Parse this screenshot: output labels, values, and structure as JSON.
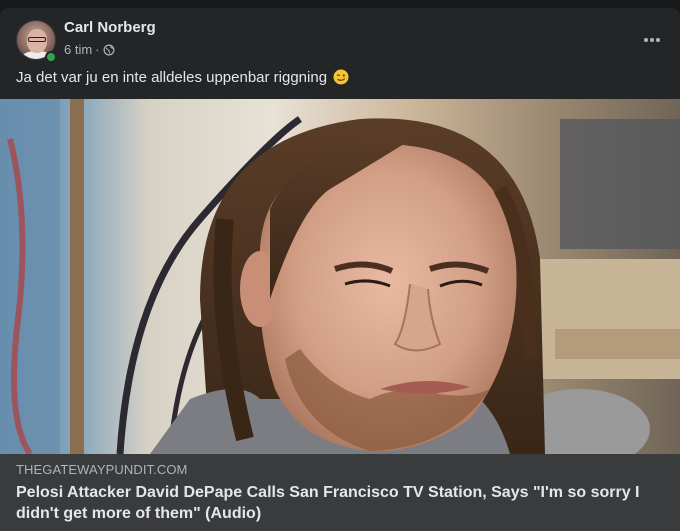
{
  "post": {
    "author": "Carl Norberg",
    "time": "6 tim",
    "separator": "·",
    "text": "Ja det var ju en inte alldeles uppenbar riggning",
    "emoji": "winking-face-emoji",
    "privacy_icon": "globe-icon",
    "more_icon": "more-options-icon"
  },
  "link": {
    "domain": "THEGATEWAYPUNDIT.COM",
    "title": "Pelosi Attacker David DePape Calls San Francisco TV Station, Says \"I'm so sorry I didn't get more of them\" (Audio)"
  },
  "colors": {
    "page_bg": "#18191a",
    "card_bg": "#242526",
    "link_info_bg": "#3a3b3c",
    "primary_text": "#e4e6eb",
    "secondary_text": "#b0b3b8",
    "online_green": "#31a24c"
  }
}
